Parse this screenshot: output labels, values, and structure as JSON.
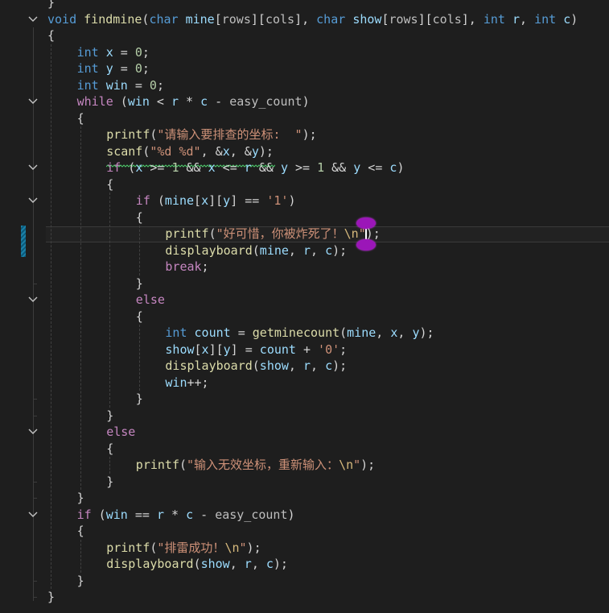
{
  "editor": {
    "colors": {
      "background": "#1e1e1e",
      "keyword": "#569cd6",
      "control": "#c586c0",
      "function": "#dcdcaa",
      "variable": "#9cdcfe",
      "param": "#9cdcfe",
      "macro": "#bebebe",
      "string": "#ce9178",
      "escape": "#d7ba7d",
      "number": "#b5cea8",
      "plain": "#d4d4d4",
      "squiggle": "#4ec96b",
      "marker": "#1b81a8",
      "selection_knob": "#9b16b8"
    },
    "lines": [
      {
        "indent": 0,
        "tokens": [
          [
            "}",
            "plain"
          ]
        ]
      },
      {
        "indent": 0,
        "tokens": [
          [
            "void",
            "keyword"
          ],
          [
            " ",
            "plain"
          ],
          [
            "findmine",
            "function"
          ],
          [
            "(",
            "plain"
          ],
          [
            "char",
            "keyword"
          ],
          [
            " ",
            "plain"
          ],
          [
            "mine",
            "param"
          ],
          [
            "[",
            "plain"
          ],
          [
            "rows",
            "macro"
          ],
          [
            "][",
            "plain"
          ],
          [
            "cols",
            "macro"
          ],
          [
            "], ",
            "plain"
          ],
          [
            "char",
            "keyword"
          ],
          [
            " ",
            "plain"
          ],
          [
            "show",
            "param"
          ],
          [
            "[",
            "plain"
          ],
          [
            "rows",
            "macro"
          ],
          [
            "][",
            "plain"
          ],
          [
            "cols",
            "macro"
          ],
          [
            "], ",
            "plain"
          ],
          [
            "int",
            "keyword"
          ],
          [
            " ",
            "plain"
          ],
          [
            "r",
            "param"
          ],
          [
            ", ",
            "plain"
          ],
          [
            "int",
            "keyword"
          ],
          [
            " ",
            "plain"
          ],
          [
            "c",
            "param"
          ],
          [
            ")",
            "plain"
          ]
        ]
      },
      {
        "indent": 0,
        "tokens": [
          [
            "{",
            "plain"
          ]
        ]
      },
      {
        "indent": 1,
        "tokens": [
          [
            "int",
            "keyword"
          ],
          [
            " ",
            "plain"
          ],
          [
            "x",
            "variable"
          ],
          [
            " = ",
            "plain"
          ],
          [
            "0",
            "number"
          ],
          [
            ";",
            "plain"
          ]
        ]
      },
      {
        "indent": 1,
        "tokens": [
          [
            "int",
            "keyword"
          ],
          [
            " ",
            "plain"
          ],
          [
            "y",
            "variable"
          ],
          [
            " = ",
            "plain"
          ],
          [
            "0",
            "number"
          ],
          [
            ";",
            "plain"
          ]
        ]
      },
      {
        "indent": 1,
        "tokens": [
          [
            "int",
            "keyword"
          ],
          [
            " ",
            "plain"
          ],
          [
            "win",
            "variable"
          ],
          [
            " = ",
            "plain"
          ],
          [
            "0",
            "number"
          ],
          [
            ";",
            "plain"
          ]
        ]
      },
      {
        "indent": 1,
        "tokens": [
          [
            "while",
            "control"
          ],
          [
            " (",
            "plain"
          ],
          [
            "win",
            "variable"
          ],
          [
            " < ",
            "plain"
          ],
          [
            "r",
            "param"
          ],
          [
            " * ",
            "plain"
          ],
          [
            "c",
            "param"
          ],
          [
            " - ",
            "plain"
          ],
          [
            "easy_count",
            "macro"
          ],
          [
            ")",
            "plain"
          ]
        ]
      },
      {
        "indent": 1,
        "tokens": [
          [
            "{",
            "plain"
          ]
        ]
      },
      {
        "indent": 2,
        "tokens": [
          [
            "printf",
            "function"
          ],
          [
            "(",
            "plain"
          ],
          [
            "\"请输入要排查的坐标:  \"",
            "string"
          ],
          [
            ");",
            "plain"
          ]
        ]
      },
      {
        "indent": 2,
        "tokens": [
          [
            "scanf",
            "function"
          ],
          [
            "(",
            "plain"
          ],
          [
            "\"%d %d\"",
            "string"
          ],
          [
            ", &",
            "plain"
          ],
          [
            "x",
            "variable"
          ],
          [
            ", &",
            "plain"
          ],
          [
            "y",
            "variable"
          ],
          [
            ");",
            "plain"
          ]
        ]
      },
      {
        "indent": 2,
        "tokens": [
          [
            "if",
            "control"
          ],
          [
            " (",
            "plain"
          ],
          [
            "x",
            "variable"
          ],
          [
            " >= ",
            "plain"
          ],
          [
            "1",
            "number"
          ],
          [
            " && ",
            "plain"
          ],
          [
            "x",
            "variable"
          ],
          [
            " <= ",
            "plain"
          ],
          [
            "r",
            "param"
          ],
          [
            " && ",
            "plain"
          ],
          [
            "y",
            "variable"
          ],
          [
            " >= ",
            "plain"
          ],
          [
            "1",
            "number"
          ],
          [
            " && ",
            "plain"
          ],
          [
            "y",
            "variable"
          ],
          [
            " <= ",
            "plain"
          ],
          [
            "c",
            "param"
          ],
          [
            ")",
            "plain"
          ]
        ]
      },
      {
        "indent": 2,
        "tokens": [
          [
            "{",
            "plain"
          ]
        ]
      },
      {
        "indent": 3,
        "tokens": [
          [
            "if",
            "control"
          ],
          [
            " (",
            "plain"
          ],
          [
            "mine",
            "param"
          ],
          [
            "[",
            "plain"
          ],
          [
            "x",
            "variable"
          ],
          [
            "][",
            "plain"
          ],
          [
            "y",
            "variable"
          ],
          [
            "] == ",
            "plain"
          ],
          [
            "'1'",
            "string"
          ],
          [
            ")",
            "plain"
          ]
        ]
      },
      {
        "indent": 3,
        "tokens": [
          [
            "{",
            "plain"
          ]
        ]
      },
      {
        "indent": 4,
        "tokens": [
          [
            "printf",
            "function"
          ],
          [
            "(",
            "plain"
          ],
          [
            "\"好可惜，你被炸死了！",
            "string"
          ],
          [
            "\\n",
            "escape"
          ],
          [
            "\"",
            "string"
          ],
          [
            ");",
            "plain"
          ]
        ]
      },
      {
        "indent": 4,
        "tokens": [
          [
            "displayboard",
            "function"
          ],
          [
            "(",
            "plain"
          ],
          [
            "mine",
            "param"
          ],
          [
            ", ",
            "plain"
          ],
          [
            "r",
            "param"
          ],
          [
            ", ",
            "plain"
          ],
          [
            "c",
            "param"
          ],
          [
            ");",
            "plain"
          ]
        ]
      },
      {
        "indent": 4,
        "tokens": [
          [
            "break",
            "control"
          ],
          [
            ";",
            "plain"
          ]
        ]
      },
      {
        "indent": 3,
        "tokens": [
          [
            "}",
            "plain"
          ]
        ]
      },
      {
        "indent": 3,
        "tokens": [
          [
            "else",
            "control"
          ]
        ]
      },
      {
        "indent": 3,
        "tokens": [
          [
            "{",
            "plain"
          ]
        ]
      },
      {
        "indent": 4,
        "tokens": [
          [
            "int",
            "keyword"
          ],
          [
            " ",
            "plain"
          ],
          [
            "count",
            "variable"
          ],
          [
            " = ",
            "plain"
          ],
          [
            "getminecount",
            "function"
          ],
          [
            "(",
            "plain"
          ],
          [
            "mine",
            "param"
          ],
          [
            ", ",
            "plain"
          ],
          [
            "x",
            "variable"
          ],
          [
            ", ",
            "plain"
          ],
          [
            "y",
            "variable"
          ],
          [
            ");",
            "plain"
          ]
        ]
      },
      {
        "indent": 4,
        "tokens": [
          [
            "show",
            "param"
          ],
          [
            "[",
            "plain"
          ],
          [
            "x",
            "variable"
          ],
          [
            "][",
            "plain"
          ],
          [
            "y",
            "variable"
          ],
          [
            "] = ",
            "plain"
          ],
          [
            "count",
            "variable"
          ],
          [
            " + ",
            "plain"
          ],
          [
            "'0'",
            "string"
          ],
          [
            ";",
            "plain"
          ]
        ]
      },
      {
        "indent": 4,
        "tokens": [
          [
            "displayboard",
            "function"
          ],
          [
            "(",
            "plain"
          ],
          [
            "show",
            "param"
          ],
          [
            ", ",
            "plain"
          ],
          [
            "r",
            "param"
          ],
          [
            ", ",
            "plain"
          ],
          [
            "c",
            "param"
          ],
          [
            ");",
            "plain"
          ]
        ]
      },
      {
        "indent": 4,
        "tokens": [
          [
            "win",
            "variable"
          ],
          [
            "++;",
            "plain"
          ]
        ]
      },
      {
        "indent": 3,
        "tokens": [
          [
            "}",
            "plain"
          ]
        ]
      },
      {
        "indent": 2,
        "tokens": [
          [
            "}",
            "plain"
          ]
        ]
      },
      {
        "indent": 2,
        "tokens": [
          [
            "else",
            "control"
          ]
        ]
      },
      {
        "indent": 2,
        "tokens": [
          [
            "{",
            "plain"
          ]
        ]
      },
      {
        "indent": 3,
        "tokens": [
          [
            "printf",
            "function"
          ],
          [
            "(",
            "plain"
          ],
          [
            "\"输入无效坐标，重新输入：",
            "string"
          ],
          [
            "\\n",
            "escape"
          ],
          [
            "\"",
            "string"
          ],
          [
            ");",
            "plain"
          ]
        ]
      },
      {
        "indent": 2,
        "tokens": [
          [
            "}",
            "plain"
          ]
        ]
      },
      {
        "indent": 1,
        "tokens": [
          [
            "}",
            "plain"
          ]
        ]
      },
      {
        "indent": 1,
        "tokens": [
          [
            "if",
            "control"
          ],
          [
            " (",
            "plain"
          ],
          [
            "win",
            "variable"
          ],
          [
            " == ",
            "plain"
          ],
          [
            "r",
            "param"
          ],
          [
            " * ",
            "plain"
          ],
          [
            "c",
            "param"
          ],
          [
            " - ",
            "plain"
          ],
          [
            "easy_count",
            "macro"
          ],
          [
            ")",
            "plain"
          ]
        ]
      },
      {
        "indent": 1,
        "tokens": [
          [
            "{",
            "plain"
          ]
        ]
      },
      {
        "indent": 2,
        "tokens": [
          [
            "printf",
            "function"
          ],
          [
            "(",
            "plain"
          ],
          [
            "\"排雷成功！",
            "string"
          ],
          [
            "\\n",
            "escape"
          ],
          [
            "\"",
            "string"
          ],
          [
            ");",
            "plain"
          ]
        ]
      },
      {
        "indent": 2,
        "tokens": [
          [
            "displayboard",
            "function"
          ],
          [
            "(",
            "plain"
          ],
          [
            "show",
            "param"
          ],
          [
            ", ",
            "plain"
          ],
          [
            "r",
            "param"
          ],
          [
            ", ",
            "plain"
          ],
          [
            "c",
            "param"
          ],
          [
            ");",
            "plain"
          ]
        ]
      },
      {
        "indent": 1,
        "tokens": [
          [
            "}",
            "plain"
          ]
        ]
      },
      {
        "indent": 0,
        "tokens": [
          [
            "}",
            "plain"
          ]
        ]
      }
    ],
    "folds": [
      1,
      6,
      10,
      12,
      18,
      26,
      31
    ],
    "current_line": 14
  }
}
